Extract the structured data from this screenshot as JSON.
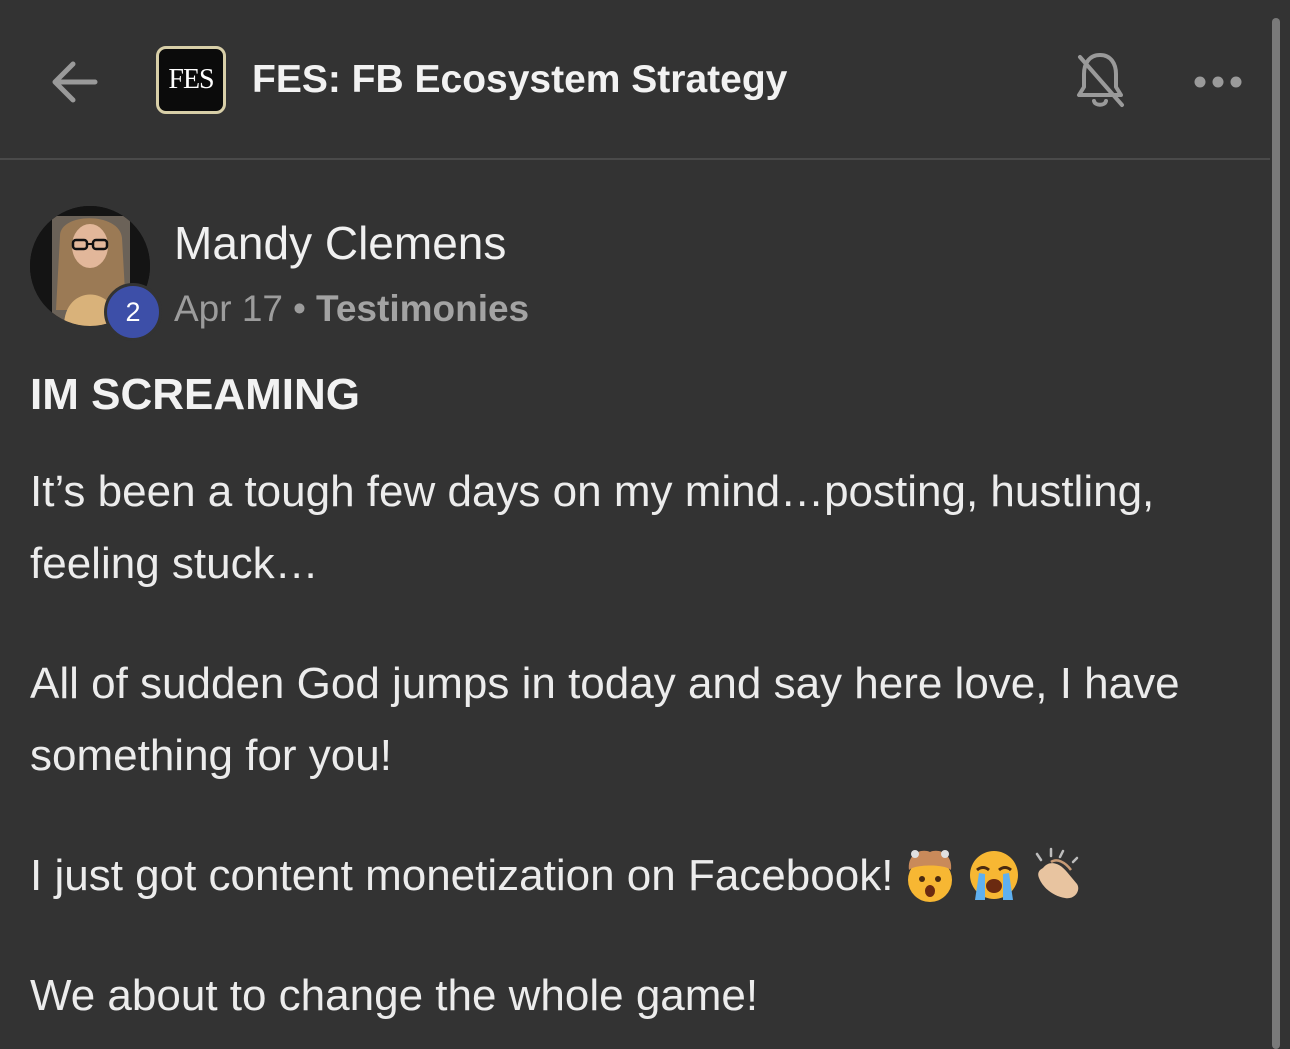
{
  "header": {
    "group_logo_text": "FES",
    "group_title": "FES: FB Ecosystem Strategy",
    "icons": [
      "back-arrow-icon",
      "bell-off-icon",
      "more-dots-icon"
    ]
  },
  "post": {
    "author": "Mandy Clemens",
    "level": "2",
    "date": "Apr 17",
    "separator": "•",
    "category": "Testimonies",
    "title": "IM SCREAMING",
    "paragraphs": [
      "It’s been a tough few days on my mind…posting, hustling, feeling stuck…",
      "All of sudden God jumps in today and say here love, I have something for you!",
      "I just got content monetization on Facebook!",
      "We about to change the whole game!"
    ],
    "emojis": [
      "exploding-head-emoji",
      "loudly-crying-face-emoji",
      "clapping-hands-emoji"
    ]
  },
  "colors": {
    "background": "#333333",
    "badge": "#3d4fa8",
    "text": "#ececec",
    "muted": "#9c9c9c"
  }
}
